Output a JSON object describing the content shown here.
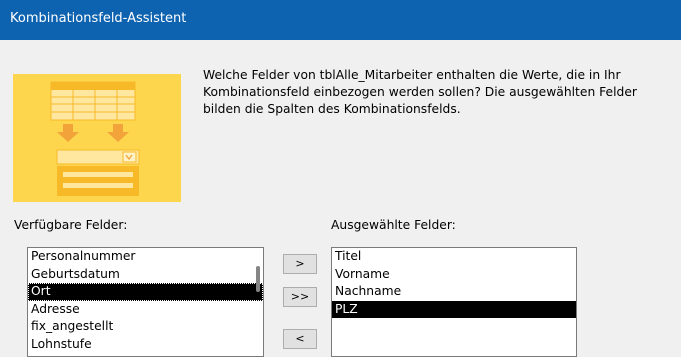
{
  "window": {
    "title": "Kombinationsfeld-Assistent"
  },
  "description": "Welche Felder von tblAlle_Mitarbeiter enthalten die Werte, die in Ihr Kombinationsfeld einbezogen werden sollen? Die ausgewählten Felder bilden die Spalten des Kombinationsfelds.",
  "available": {
    "label": "Verfügbare Felder:",
    "items": [
      "Personalnummer",
      "Geburtsdatum",
      "Ort",
      "Adresse",
      "fix_angestellt",
      "Lohnstufe"
    ],
    "selected_item": "Ort"
  },
  "selected": {
    "label": "Ausgewählte Felder:",
    "items": [
      "Titel",
      "Vorname",
      "Nachname",
      "PLZ"
    ],
    "selected_item": "PLZ"
  },
  "buttons": {
    "add_one": ">",
    "add_all": ">>",
    "remove_one": "<"
  },
  "colors": {
    "titlebar": "#0e63b0",
    "wizard_art": "#fdd64e",
    "selection": "#000000"
  }
}
